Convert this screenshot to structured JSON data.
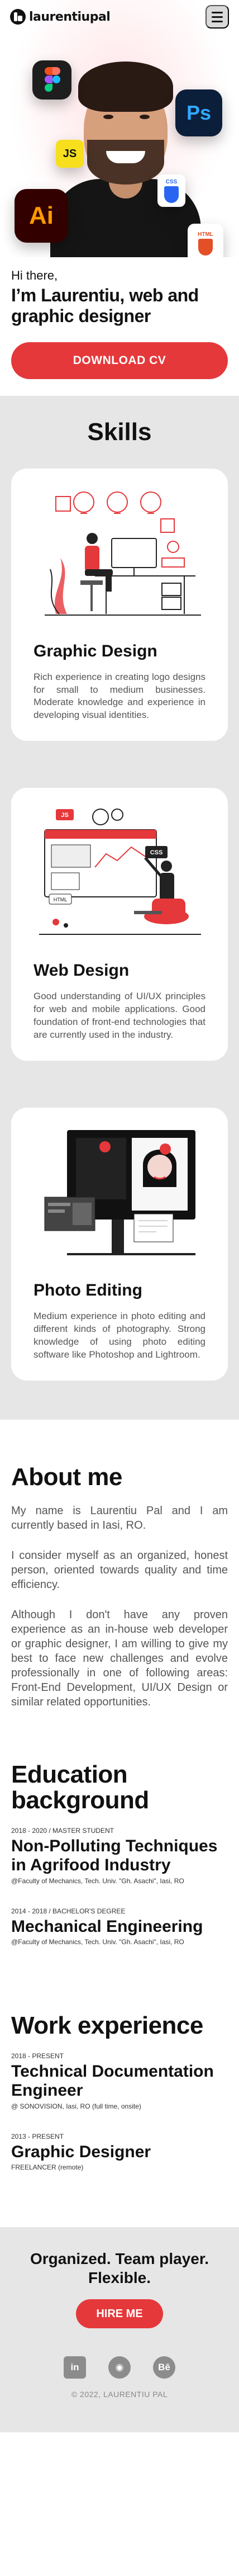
{
  "header": {
    "logo_text": "laurentiupal",
    "menu_icon": "hamburger-icon"
  },
  "hero": {
    "icons": [
      "figma-icon",
      "photoshop-icon",
      "javascript-icon",
      "css3-icon",
      "illustrator-icon",
      "html5-icon"
    ],
    "ps_label": "Ps",
    "js_label": "JS",
    "ai_label": "Ai",
    "css_label": "CSS",
    "html_label": "HTML"
  },
  "intro": {
    "greeting": "Hi there,",
    "headline": "I’m Laurentiu, web and graphic designer",
    "cta_label": "DOWNLOAD CV"
  },
  "skills": {
    "title": "Skills",
    "items": [
      {
        "title": "Graphic Design",
        "description": "Rich experience in creating logo designs for small to medium businesses. Moderate knowledge and experience in developing visual identities."
      },
      {
        "title": "Web Design",
        "description": "Good understanding of UI/UX principles for web and mobile applications. Good foundation of front-end technologies that are currently used in the industry.",
        "illus_tags": [
          "JS",
          "CSS",
          "HTML"
        ]
      },
      {
        "title": "Photo Editing",
        "description": "Medium experience in photo editing and different kinds of photography. Strong knowledge of using photo editing software like Photoshop and Lightroom."
      }
    ]
  },
  "about": {
    "title": "About me",
    "paragraphs": [
      "My name is Laurentiu Pal and I am currently based in Iasi, RO.",
      "I consider myself as an organized, honest person, oriented towards quality and time efficiency.",
      "Although I don't have any proven experience as an in-house web developer or graphic designer, I am willing to give my best to face new challenges and evolve professionally in one of following areas: Front-End Development, UI/UX Design or similar related opportunities."
    ]
  },
  "education": {
    "title": "Education background",
    "entries": [
      {
        "meta": "2018 - 2020 / MASTER STUDENT",
        "title": "Non-Polluting Techniques in Agrifood Industry",
        "sub": "@Faculty of Mechanics, Tech. Univ. \"Gh. Asachi\", Iasi, RO"
      },
      {
        "meta": "2014 - 2018 / BACHELOR'S DEGREE",
        "title": "Mechanical Engineering",
        "sub": "@Faculty of Mechanics, Tech. Univ. \"Gh. Asachi\", Iasi, RO"
      }
    ]
  },
  "work": {
    "title": "Work experience",
    "entries": [
      {
        "meta": "2018 - PRESENT",
        "title": "Technical Documentation Engineer",
        "sub": "@ SONOVISION, Iasi, RO (full time, onsite)"
      },
      {
        "meta": "2013 - PRESENT",
        "title": "Graphic Designer",
        "sub": "FREELANCER (remote)"
      }
    ]
  },
  "footer": {
    "tagline": "Organized. Team player. Flexible.",
    "hire_label": "HIRE ME",
    "socials": [
      {
        "icon": "linkedin-icon",
        "glyph": "in"
      },
      {
        "icon": "github-icon",
        "glyph": "◉"
      },
      {
        "icon": "behance-icon",
        "glyph": "Bē"
      }
    ],
    "copyright": "© 2022, LAURENTIU PAL"
  },
  "colors": {
    "accent": "#e5383b",
    "section_bg": "#e6e6e6",
    "text": "#111111",
    "muted": "#555555"
  }
}
